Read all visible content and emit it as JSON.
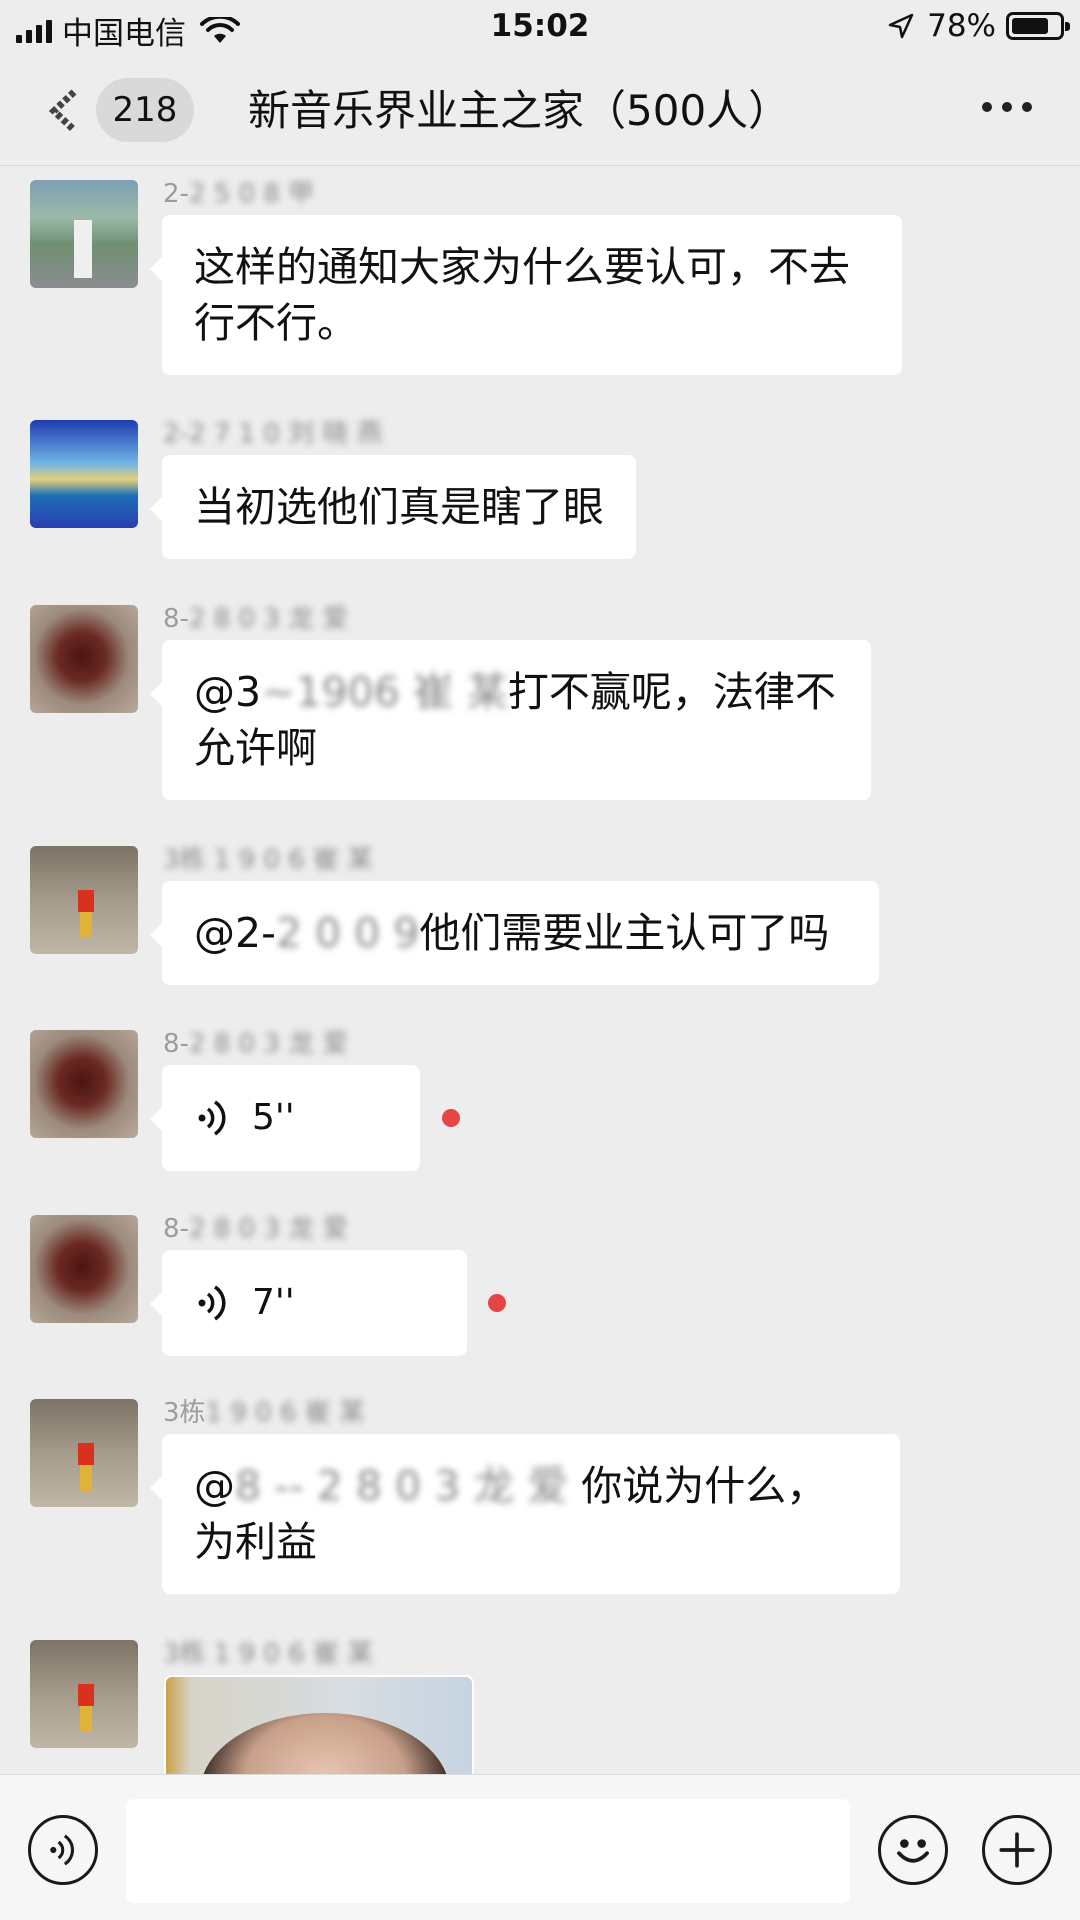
{
  "status_bar": {
    "carrier": "中国电信",
    "time": "15:02",
    "battery_percent_text": "78%",
    "battery_level": 0.78
  },
  "nav": {
    "unread_count": "218",
    "title": "新音乐界业主之家（500人）"
  },
  "messages": [
    {
      "sender_visible": "2-",
      "sender_blurred": "2 5 0 8  甲",
      "text": "这样的通知大家为什么要认可，不去行不行。"
    },
    {
      "sender_visible": "",
      "sender_blurred": "2-2 7 1 0 刘 晓 燕",
      "text": "当初选他们真是瞎了眼"
    },
    {
      "sender_visible": "8-",
      "sender_blurred": "2 8 0 3 龙 爱",
      "text_prefix": "@3",
      "text_mention_blurred": "~1906  崔 某",
      "text_suffix": "打不赢呢，法律不允许啊"
    },
    {
      "sender_visible": "",
      "sender_blurred": "3栋 1 9 0 6 崔 某",
      "text_prefix": "@2-",
      "text_mention_blurred": "2 0 0 9",
      "text_suffix": "他们需要业主认可了吗"
    },
    {
      "sender_visible": "8-",
      "sender_blurred": "2 8 0 3 龙 爱",
      "voice_duration": "5''",
      "unread": true
    },
    {
      "sender_visible": "8-",
      "sender_blurred": "2 8 0 3 龙 爱",
      "voice_duration": "7''",
      "unread": true
    },
    {
      "sender_visible": "3栋",
      "sender_blurred": "1 9 0 6 崔 某",
      "text_prefix": "@",
      "text_mention_blurred": "8 -- 2 8 0 3 龙 爱",
      "text_suffix": " 你说为什么，为利益"
    },
    {
      "sender_visible": "",
      "sender_blurred": "3栋 1 9 0 6 崔 某",
      "image": "photo-message"
    }
  ],
  "input_bar": {
    "voice_icon": "voice-mode-icon",
    "emoji_icon": "emoji-icon",
    "plus_icon": "plus-icon"
  },
  "colors": {
    "background": "#ededed",
    "bubble": "#ffffff",
    "unread_dot": "#e64545",
    "sender_name": "#9c9c9c"
  }
}
